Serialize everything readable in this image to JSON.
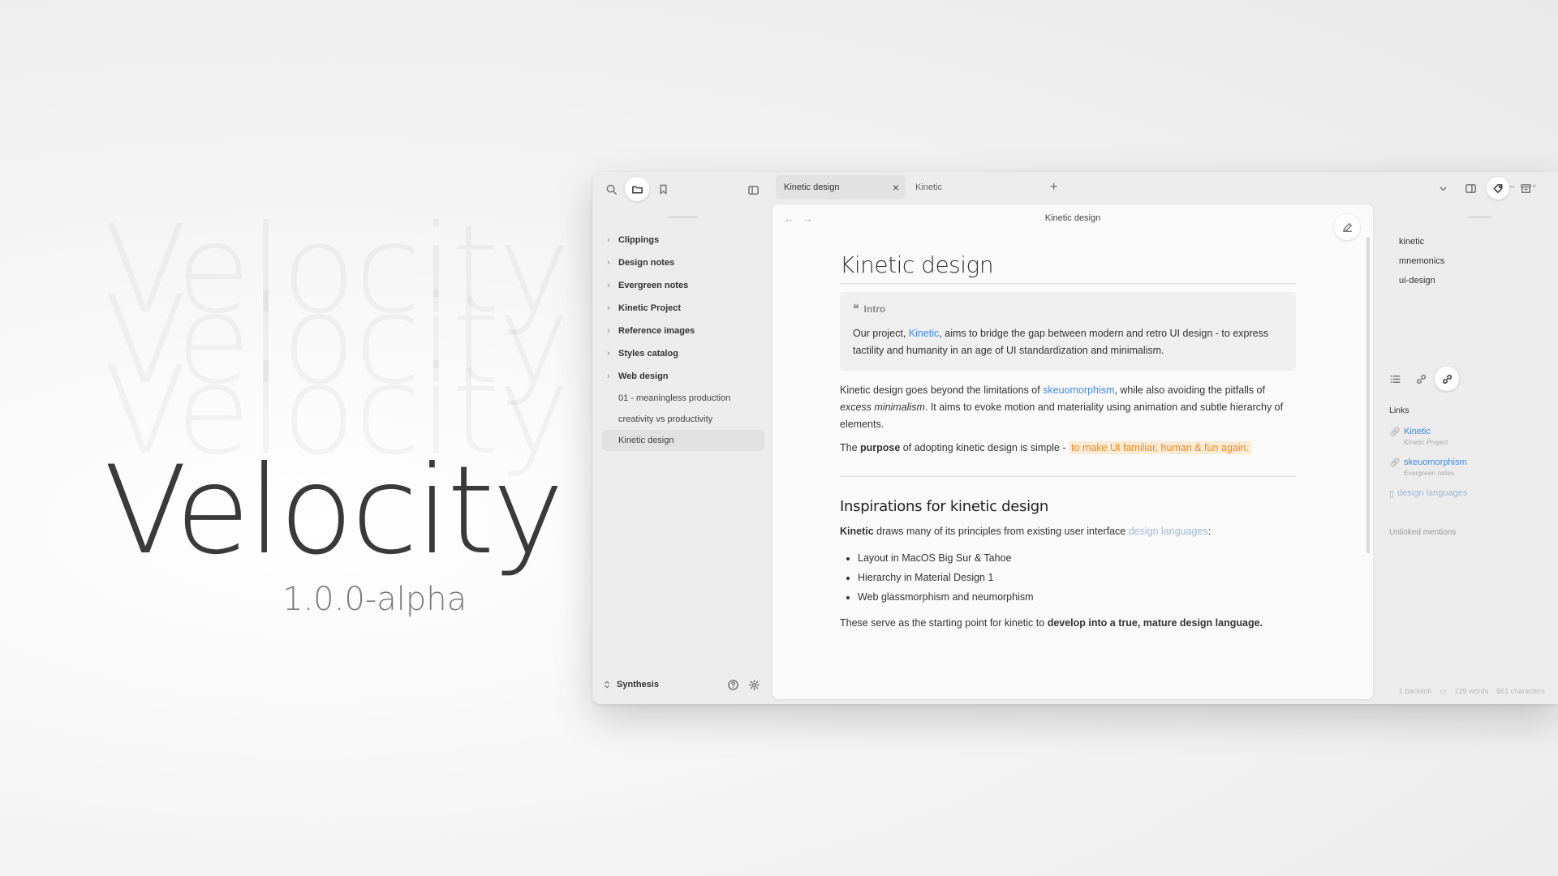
{
  "hero": {
    "title": "Velocity",
    "version": "1.0.0-alpha"
  },
  "sidebar": {
    "folders": [
      "Clippings",
      "Design notes",
      "Evergreen notes",
      "Kinetic Project",
      "Reference images",
      "Styles catalog",
      "Web design"
    ],
    "files": [
      "01 - meaningless production",
      "creativity vs productivity",
      "Kinetic design"
    ],
    "active_file": "Kinetic design",
    "vault": "Synthesis"
  },
  "tabs": [
    {
      "label": "Kinetic design",
      "active": true
    },
    {
      "label": "Kinetic",
      "active": false
    }
  ],
  "editor": {
    "header_title": "Kinetic design",
    "title": "Kinetic design",
    "callout": {
      "label": "Intro",
      "text_1": "Our project, ",
      "link": "Kinetic",
      "text_2": ", aims to bridge the gap between modern and retro UI design - to express tactility and humanity in an age of UI standardization and minimalism."
    },
    "para1": {
      "a": "Kinetic design goes beyond the limitations of ",
      "link": "skeuomorphism",
      "b": ", while also avoiding the pitfalls of ",
      "em": "excess minimalism",
      "c": ". It aims to evoke motion and materiality using animation and subtle hierarchy of elements."
    },
    "para2": {
      "a": "The ",
      "bold": "purpose",
      "b": " of adopting kinetic design is simple - ",
      "highlight": "to make UI familiar, human & fun again."
    },
    "h2": "Inspirations for kinetic design",
    "para3": {
      "bold": "Kinetic",
      "a": " draws many of its principles from existing user interface ",
      "link": "design languages",
      "b": ":"
    },
    "bullets": [
      "Layout in MacOS Big Sur & Tahoe",
      "Hierarchy in Material Design 1",
      "Web glassmorphism and neumorphism"
    ],
    "para4": {
      "a": "These serve as the starting point for kinetic to ",
      "bold": "develop into a true, mature design language."
    }
  },
  "right_pane": {
    "tags": [
      "kinetic",
      "mnemonics",
      "ui-design"
    ],
    "links_heading": "Links",
    "links": [
      {
        "title": "Kinetic",
        "sub": "Kinetic Project"
      },
      {
        "title": "skeuomorphism",
        "sub": "Evergreen notes"
      },
      {
        "title": "design languages",
        "sub": ""
      }
    ],
    "unlinked": "Unlinked mentions",
    "status": {
      "backlinks": "1 backlink",
      "words": "129 words",
      "chars": "861 characters"
    }
  },
  "colors": {
    "link": "#3d8ae6",
    "highlight": "#f08a1c",
    "highlight_bg": "#fdebd6"
  }
}
